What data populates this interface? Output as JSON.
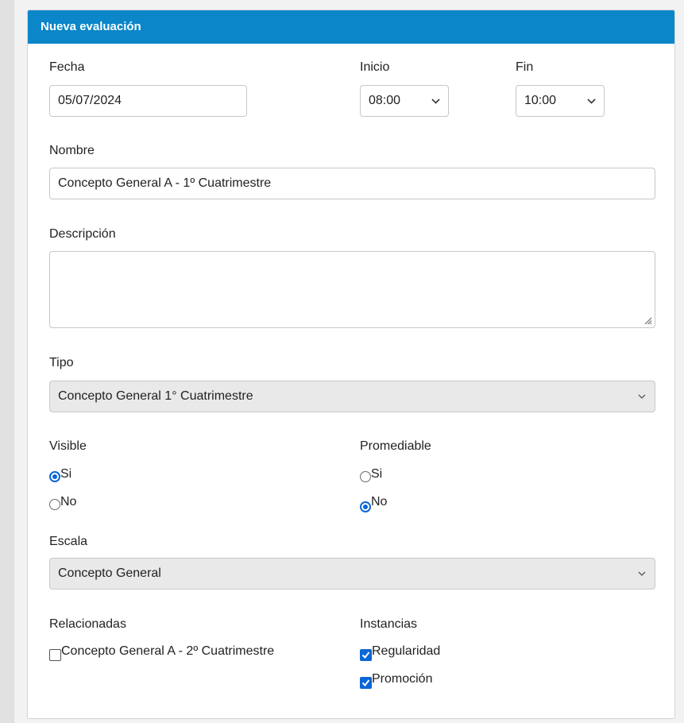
{
  "panel": {
    "title": "Nueva evaluación"
  },
  "fecha": {
    "label": "Fecha",
    "value": "05/07/2024"
  },
  "inicio": {
    "label": "Inicio",
    "value": "08:00"
  },
  "fin": {
    "label": "Fin",
    "value": "10:00"
  },
  "nombre": {
    "label": "Nombre",
    "value": "Concepto General A - 1º Cuatrimestre"
  },
  "descripcion": {
    "label": "Descripción",
    "value": ""
  },
  "tipo": {
    "label": "Tipo",
    "value": "Concepto General 1° Cuatrimestre"
  },
  "visible": {
    "label": "Visible",
    "options": [
      {
        "label": "Si",
        "checked": true
      },
      {
        "label": "No",
        "checked": false
      }
    ]
  },
  "promediable": {
    "label": "Promediable",
    "options": [
      {
        "label": "Si",
        "checked": false
      },
      {
        "label": "No",
        "checked": true
      }
    ]
  },
  "escala": {
    "label": "Escala",
    "value": "Concepto General"
  },
  "relacionadas": {
    "label": "Relacionadas",
    "items": [
      {
        "label": "Concepto General A - 2º Cuatrimestre",
        "checked": false
      }
    ]
  },
  "instancias": {
    "label": "Instancias",
    "items": [
      {
        "label": "Regularidad",
        "checked": true
      },
      {
        "label": "Promoción",
        "checked": true
      }
    ]
  },
  "colors": {
    "header": "#0a86c9",
    "accent": "#0a66d6"
  }
}
